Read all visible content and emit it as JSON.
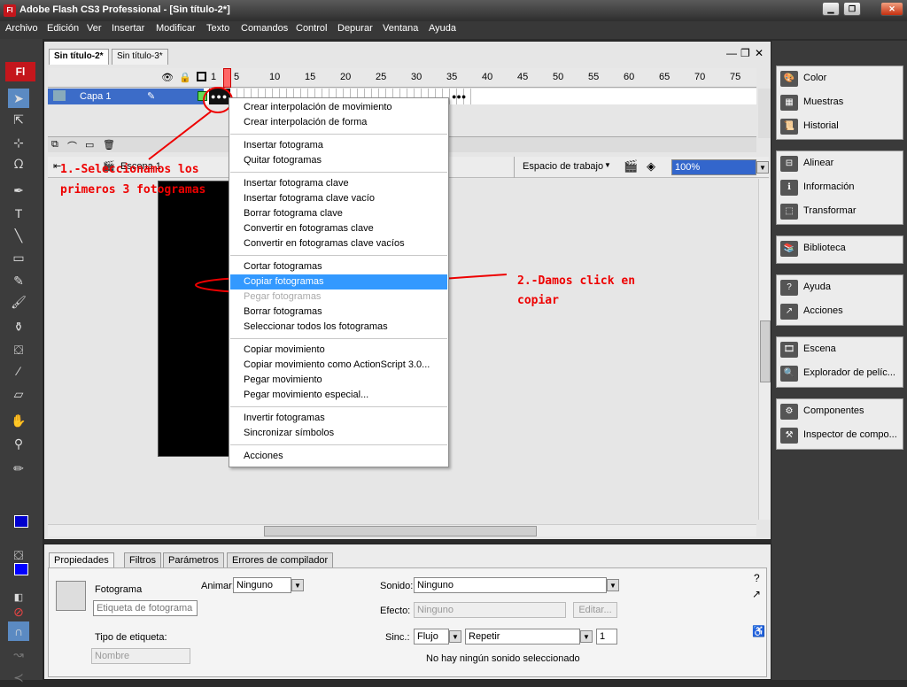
{
  "window": {
    "title": "Adobe Flash CS3 Professional - [Sin título-2*]",
    "app_icon": "Fl"
  },
  "menubar": [
    "Archivo",
    "Edición",
    "Ver",
    "Insertar",
    "Modificar",
    "Texto",
    "Comandos",
    "Control",
    "Depurar",
    "Ventana",
    "Ayuda"
  ],
  "doc_tabs": [
    "Sin título-2*",
    "Sin título-3*"
  ],
  "timeline": {
    "frame_ticks": [
      "1",
      "5",
      "10",
      "15",
      "20",
      "25",
      "30",
      "35",
      "40",
      "45",
      "50",
      "55",
      "60",
      "65",
      "70",
      "75"
    ],
    "layer_name": "Capa 1"
  },
  "edit_bar": {
    "scene": "Escena 1",
    "workspace": "Espacio de trabajo",
    "zoom": "100%"
  },
  "context_menu": {
    "groups": [
      [
        "Crear interpolación de movimiento",
        "Crear interpolación de forma"
      ],
      [
        "Insertar fotograma",
        "Quitar fotogramas"
      ],
      [
        "Insertar fotograma clave",
        "Insertar fotograma clave vacío",
        "Borrar fotograma clave",
        "Convertir en fotogramas clave",
        "Convertir en fotogramas clave vacíos"
      ],
      [
        "Cortar fotogramas",
        "Copiar fotogramas",
        "Pegar fotogramas",
        "Borrar fotogramas",
        "Seleccionar todos los fotogramas"
      ],
      [
        "Copiar movimiento",
        "Copiar movimiento como ActionScript 3.0...",
        "Pegar movimiento",
        "Pegar movimiento especial..."
      ],
      [
        "Invertir fotogramas",
        "Sincronizar símbolos"
      ],
      [
        "Acciones"
      ]
    ],
    "highlighted": "Copiar fotogramas",
    "disabled": [
      "Pegar fotogramas"
    ]
  },
  "annotations": {
    "a1_line1": "1.-Seleccionamos los",
    "a1_line2": "primeros 3 fotogramas",
    "a2_line1": "2.-Damos click en",
    "a2_line2": "copiar"
  },
  "panels": {
    "group1": [
      "Color",
      "Muestras",
      "Historial"
    ],
    "group2": [
      "Alinear",
      "Información",
      "Transformar"
    ],
    "group3": [
      "Biblioteca"
    ],
    "group4": [
      "Ayuda",
      "Acciones"
    ],
    "group5": [
      "Escena",
      "Explorador de pelíc..."
    ],
    "group6": [
      "Componentes",
      "Inspector de compo..."
    ]
  },
  "properties": {
    "tabs": [
      "Propiedades",
      "Filtros",
      "Parámetros",
      "Errores de compilador"
    ],
    "frame_label": "Fotograma",
    "frame_name_placeholder": "Etiqueta de fotograma",
    "tween_label": "Animar:",
    "tween_value": "Ninguno",
    "label_type_label": "Tipo de etiqueta:",
    "label_type_value": "Nombre",
    "sound_label": "Sonido:",
    "sound_value": "Ninguno",
    "effect_label": "Efecto:",
    "effect_value": "Ninguno",
    "edit_button": "Editar...",
    "sync_label": "Sinc.:",
    "sync_value": "Flujo",
    "repeat_value": "Repetir",
    "repeat_count": "1",
    "status": "No hay ningún sonido seleccionado"
  },
  "colors": {
    "accent": "#3399ff",
    "annotation": "#ee0000",
    "ui_dark": "#3c3c3c"
  }
}
